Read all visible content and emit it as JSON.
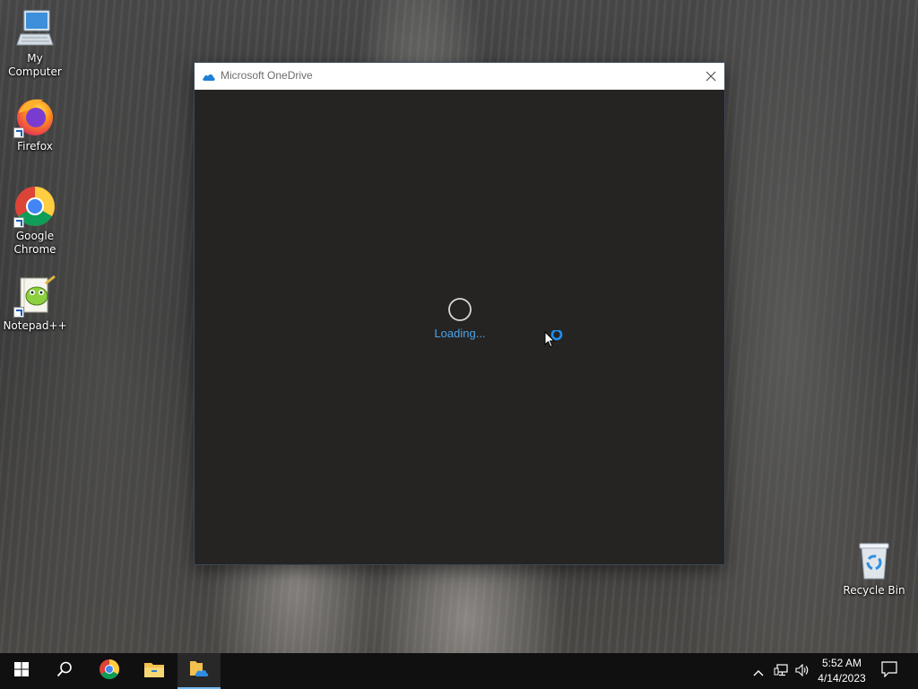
{
  "desktop": {
    "icons": [
      {
        "label": "My Computer",
        "icon": "computer-icon"
      },
      {
        "label": "Firefox",
        "icon": "firefox-icon"
      },
      {
        "label": "Google\nChrome",
        "icon": "chrome-icon"
      },
      {
        "label": "Notepad++",
        "icon": "notepad-plus-plus-icon"
      },
      {
        "label": "Recycle Bin",
        "icon": "recycle-bin-icon"
      }
    ]
  },
  "window": {
    "title": "Microsoft OneDrive",
    "title_icon": "onedrive-cloud-icon",
    "close_icon": "close-icon",
    "loading_text": "Loading...",
    "background": "#252423",
    "accent": "#4aa3e8"
  },
  "taskbar": {
    "buttons": [
      {
        "name": "start",
        "icon": "windows-logo-icon"
      },
      {
        "name": "search",
        "icon": "search-icon"
      },
      {
        "name": "chrome",
        "icon": "chrome-icon"
      },
      {
        "name": "file-explorer",
        "icon": "folder-icon"
      },
      {
        "name": "onedrive",
        "icon": "onedrive-folder-icon",
        "active": true
      }
    ],
    "tray": {
      "icons": [
        "chevron-up-icon",
        "network-icon",
        "volume-icon"
      ],
      "time": "5:52 AM",
      "date": "4/14/2023",
      "notification_icon": "notification-icon"
    }
  }
}
